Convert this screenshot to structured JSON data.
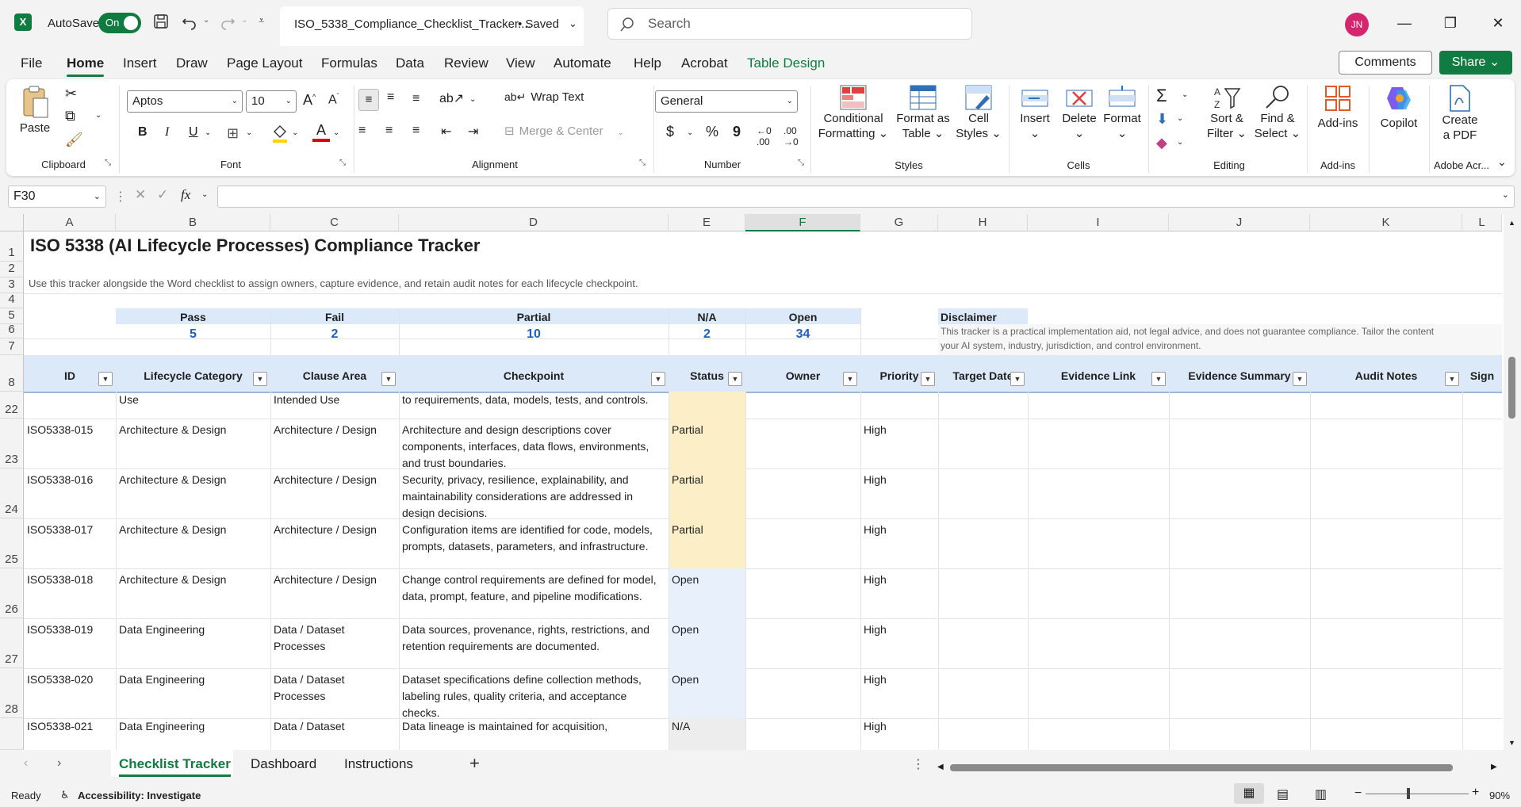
{
  "titlebar": {
    "autosave_label": "AutoSave",
    "autosave_state": "On",
    "filename": "ISO_5338_Compliance_Checklist_Tracker....",
    "save_status": "• Saved",
    "search_placeholder": "Search",
    "user_initials": "JN"
  },
  "menu": {
    "items": [
      "File",
      "Home",
      "Insert",
      "Draw",
      "Page Layout",
      "Formulas",
      "Data",
      "Review",
      "View",
      "Automate",
      "Help",
      "Acrobat",
      "Table Design"
    ],
    "comments_label": "Comments",
    "share_label": "Share"
  },
  "ribbon": {
    "clipboard": {
      "paste": "Paste",
      "label": "Clipboard"
    },
    "font": {
      "family": "Aptos",
      "size": "10",
      "label": "Font",
      "bold": "B",
      "italic": "I",
      "underline": "U"
    },
    "alignment": {
      "wrap": "Wrap Text",
      "merge": "Merge & Center",
      "label": "Alignment"
    },
    "number": {
      "format": "General",
      "label": "Number",
      "currency": "$",
      "percent": "%",
      "comma": "9"
    },
    "styles": {
      "cond1": "Conditional",
      "cond2": "Formatting",
      "fmt1": "Format as",
      "fmt2": "Table",
      "cell1": "Cell",
      "cell2": "Styles",
      "label": "Styles"
    },
    "cells": {
      "insert": "Insert",
      "delete": "Delete",
      "format": "Format",
      "label": "Cells"
    },
    "editing": {
      "sort1": "Sort &",
      "sort2": "Filter",
      "find1": "Find &",
      "find2": "Select",
      "label": "Editing",
      "sigma": "Σ"
    },
    "addins": {
      "addins": "Add-ins",
      "label": "Add-ins"
    },
    "copilot": {
      "label": "Copilot"
    },
    "adobe": {
      "create1": "Create",
      "create2": "a PDF",
      "label": "Adobe Acr..."
    }
  },
  "formula_bar": {
    "name_box": "F30",
    "fx": "fx",
    "content": ""
  },
  "columns": [
    "A",
    "B",
    "C",
    "D",
    "E",
    "F",
    "G",
    "H",
    "I",
    "J",
    "K",
    "L"
  ],
  "sheet": {
    "title": "ISO 5338 (AI Lifecycle Processes) Compliance Tracker",
    "subtitle": "Use this tracker alongside the Word checklist to assign owners, capture evidence, and retain audit notes for each lifecycle checkpoint.",
    "kpis": [
      {
        "label": "Pass",
        "value": "5"
      },
      {
        "label": "Fail",
        "value": "2"
      },
      {
        "label": "Partial",
        "value": "10"
      },
      {
        "label": "N/A",
        "value": "2"
      },
      {
        "label": "Open",
        "value": "34"
      }
    ],
    "disclaimer_title": "Disclaimer",
    "disclaimer_line1": "This tracker is a practical implementation aid, not legal advice, and does not guarantee compliance. Tailor the content",
    "disclaimer_line2": "your AI system, industry, jurisdiction, and control environment.",
    "headers": [
      "ID",
      "Lifecycle Category",
      "Clause Area",
      "Checkpoint",
      "Status",
      "Owner",
      "Priority",
      "Target Date",
      "Evidence Link",
      "Evidence Summary",
      "Audit Notes",
      "Sign"
    ],
    "partial_row": {
      "row": "22",
      "category": "Use",
      "clause": "Intended Use",
      "checkpoint": "to requirements, data, models, tests, and controls."
    },
    "rows": [
      {
        "row": "23",
        "id": "ISO5338-015",
        "category": "Architecture & Design",
        "clause": "Architecture / Design",
        "checkpoint": "Architecture and design descriptions cover components, interfaces, data flows, environments, and trust boundaries.",
        "status": "Partial",
        "priority": "High"
      },
      {
        "row": "24",
        "id": "ISO5338-016",
        "category": "Architecture & Design",
        "clause": "Architecture / Design",
        "checkpoint": "Security, privacy, resilience, explainability, and maintainability considerations are addressed in design decisions.",
        "status": "Partial",
        "priority": "High"
      },
      {
        "row": "25",
        "id": "ISO5338-017",
        "category": "Architecture & Design",
        "clause": "Architecture / Design",
        "checkpoint": "Configuration items are identified for code, models, prompts, datasets, parameters, and infrastructure.",
        "status": "Partial",
        "priority": "High"
      },
      {
        "row": "26",
        "id": "ISO5338-018",
        "category": "Architecture & Design",
        "clause": "Architecture / Design",
        "checkpoint": "Change control requirements are defined for model, data, prompt, feature, and pipeline modifications.",
        "status": "Open",
        "priority": "High"
      },
      {
        "row": "27",
        "id": "ISO5338-019",
        "category": "Data Engineering",
        "clause": "Data / Dataset Processes",
        "checkpoint": "Data sources, provenance, rights, restrictions, and retention requirements are documented.",
        "status": "Open",
        "priority": "High"
      },
      {
        "row": "28",
        "id": "ISO5338-020",
        "category": "Data Engineering",
        "clause": "Data / Dataset Processes",
        "checkpoint": "Dataset specifications define collection methods, labeling rules, quality criteria, and acceptance checks.",
        "status": "Open",
        "priority": "High"
      }
    ],
    "last_row": {
      "id": "ISO5338-021",
      "category": "Data Engineering",
      "clause": "Data / Dataset",
      "checkpoint": "Data lineage is maintained for acquisition,",
      "status": "N/A",
      "priority": "High"
    }
  },
  "row_labels": [
    "1",
    "2",
    "3",
    "4",
    "5",
    "6",
    "7",
    "8"
  ],
  "tabs": [
    "Checklist Tracker",
    "Dashboard",
    "Instructions"
  ],
  "status": {
    "ready": "Ready",
    "accessibility": "Accessibility: Investigate",
    "zoom": "90%"
  },
  "colors": {
    "accent": "#107c41",
    "partial": "#fcefc7",
    "open": "#e8f1fb",
    "na": "#ededed",
    "header_band": "#dbe9f9",
    "kpi_value": "#1f5fbf"
  }
}
